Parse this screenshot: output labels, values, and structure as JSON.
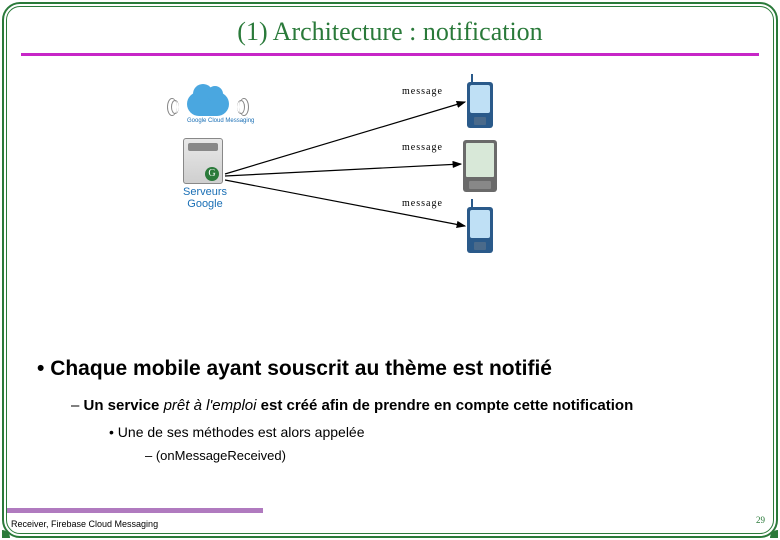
{
  "title": "(1) Architecture : notification",
  "cloud_label": "Google Cloud Messaging",
  "server_label_line1": "Serveurs",
  "server_label_line2": "Google",
  "msg1": "message",
  "msg2": "message",
  "msg3": "message",
  "bullets": {
    "l1": "Chaque mobile ayant souscrit au thème est notifié",
    "l2_pre": "Un service ",
    "l2_em": "prêt à l'emploi",
    "l2_post": " est créé afin de prendre en compte cette notification",
    "l3": "Une de ses méthodes est alors appelée",
    "l4": "(onMessageReceived)"
  },
  "footer_note": "Receiver, Firebase Cloud Messaging",
  "page_num": "29"
}
